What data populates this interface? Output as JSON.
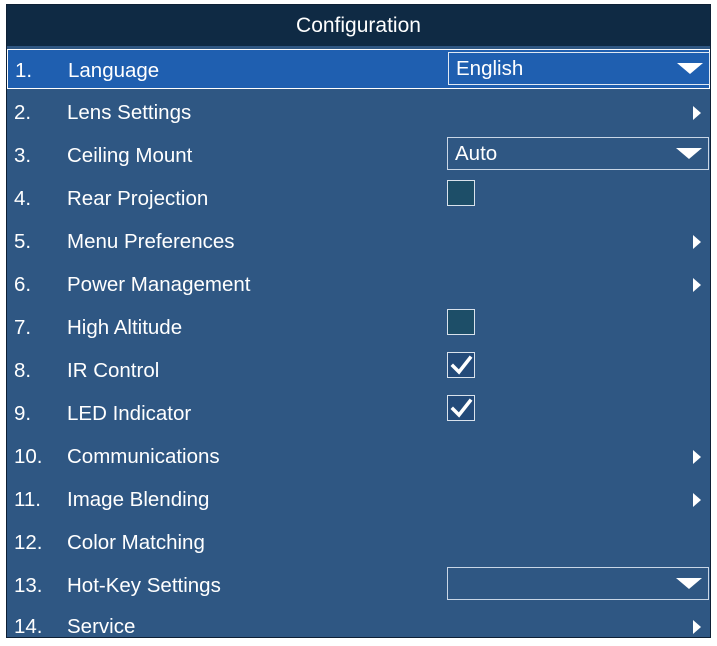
{
  "title": "Configuration",
  "rows": [
    {
      "num": "1.",
      "label": "Language",
      "control": "dropdown",
      "value": "English"
    },
    {
      "num": "2.",
      "label": "Lens Settings",
      "control": "submenu"
    },
    {
      "num": "3.",
      "label": "Ceiling Mount",
      "control": "dropdown",
      "value": "Auto"
    },
    {
      "num": "4.",
      "label": "Rear Projection",
      "control": "checkbox",
      "checked": false
    },
    {
      "num": "5.",
      "label": "Menu Preferences",
      "control": "submenu"
    },
    {
      "num": "6.",
      "label": "Power Management",
      "control": "submenu"
    },
    {
      "num": "7.",
      "label": "High Altitude",
      "control": "checkbox",
      "checked": false
    },
    {
      "num": "8.",
      "label": "IR Control",
      "control": "checkbox",
      "checked": true
    },
    {
      "num": "9.",
      "label": "LED Indicator",
      "control": "checkbox",
      "checked": true
    },
    {
      "num": "10.",
      "label": "Communications",
      "control": "submenu"
    },
    {
      "num": "11.",
      "label": "Image Blending",
      "control": "submenu"
    },
    {
      "num": "12.",
      "label": "Color Matching",
      "control": "none"
    },
    {
      "num": "13.",
      "label": "Hot-Key Settings",
      "control": "dropdown",
      "value": ""
    },
    {
      "num": "14.",
      "label": "Service",
      "control": "submenu"
    }
  ],
  "selected_row": 1,
  "colors": {
    "panel_bg": "#2f5783",
    "title_bg": "#0f2a44",
    "selected_bg": "#1f5fb0"
  }
}
